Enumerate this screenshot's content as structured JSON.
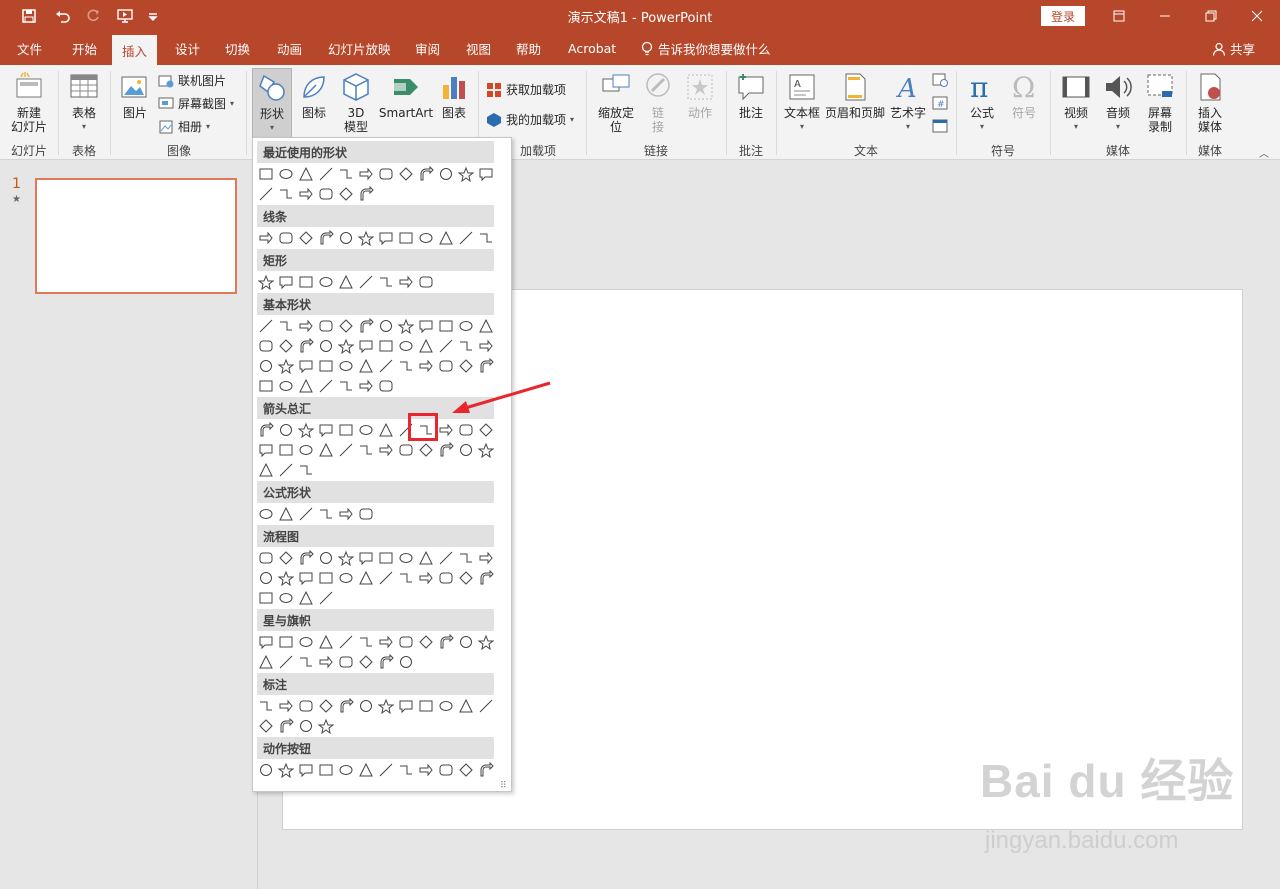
{
  "window": {
    "title": "演示文稿1  -  PowerPoint",
    "login": "登录"
  },
  "tabs": [
    "文件",
    "开始",
    "插入",
    "设计",
    "切换",
    "动画",
    "幻灯片放映",
    "审阅",
    "视图",
    "帮助",
    "Acrobat"
  ],
  "active_tab": "插入",
  "tellme": "告诉我你想要做什么",
  "share": "共享",
  "ribbon": {
    "new_slide": "新建\n幻灯片",
    "table": "表格",
    "picture": "图片",
    "online_picture": "联机图片",
    "screenshot": "屏幕截图",
    "album": "相册",
    "shapes": "形状",
    "icons": "图标",
    "model_3d": "3D\n模型",
    "smartart": "SmartArt",
    "chart": "图表",
    "get_addins": "获取加载项",
    "my_addins": "我的加载项",
    "zoom": "缩放定\n位",
    "link": "链\n接",
    "action": "动作",
    "comment": "批注",
    "textbox": "文本框",
    "header_footer": "页眉和页脚",
    "wordart": "艺术字",
    "equation": "公式",
    "symbol": "符号",
    "video": "视频",
    "audio": "音频",
    "screen_record": "屏幕\n录制",
    "insert_media": "插入\n媒体",
    "groups": {
      "slides": "幻灯片",
      "tables": "表格",
      "images": "图像",
      "addins": "加载项",
      "links": "链接",
      "comments": "批注",
      "text": "文本",
      "symbols": "符号",
      "media": "媒体",
      "media2": "媒体"
    }
  },
  "slide_pane": {
    "number": "1",
    "star": "★"
  },
  "shapes_panel": {
    "sections": [
      "最近使用的形状",
      "线条",
      "矩形",
      "基本形状",
      "箭头总汇",
      "公式形状",
      "流程图",
      "星与旗帜",
      "标注",
      "动作按钮"
    ]
  },
  "watermark": {
    "main": "Bai du 经验",
    "sub": "jingyan.baidu.com"
  },
  "colors": {
    "accent": "#b7472a",
    "highlight": "#e8262b"
  }
}
